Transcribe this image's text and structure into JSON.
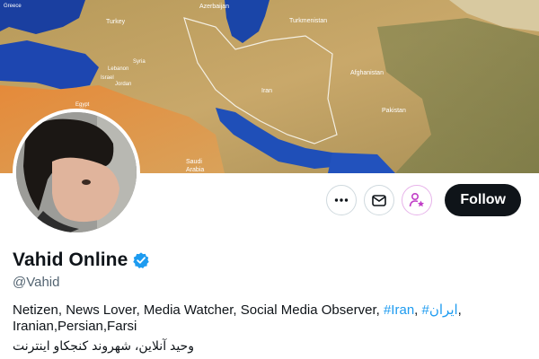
{
  "banner": {
    "map_labels": {
      "georgia": "Azerbaijan",
      "turkey": "Turkey",
      "turkmenistan": "Turkmenistan",
      "afghanistan": "Afghanistan",
      "iran": "Iran",
      "pakistan": "Pakistan",
      "saudi": "Saudi",
      "arabia": "Arabia",
      "greece": "Greece",
      "lebanon": "Lebanon",
      "jordan": "Jordan",
      "israel": "Israel",
      "egypt": "Egypt",
      "syria": "Syria"
    }
  },
  "actions": {
    "more_icon": "more-horizontal-icon",
    "message_icon": "envelope-icon",
    "subscribe_icon": "person-star-icon",
    "follow_label": "Follow"
  },
  "profile": {
    "display_name": "Vahid Online",
    "handle": "@Vahid",
    "verified_icon": "verified-badge-icon",
    "bio_prefix": "Netizen, News Lover, Media Watcher, Social Media Observer, ",
    "hashtag_1": "#Iran",
    "separator": ", ",
    "hashtag_2": "#ایران",
    "bio_suffix": ",",
    "bio_line2": "Iranian,Persian,Farsi",
    "bio_line3": "وحید آنلاین، شهروند کنجکاو اینترنت"
  },
  "colors": {
    "accent": "#1d9bf0",
    "follow_bg": "#0f1419",
    "subscribe_icon": "#c13fc7"
  }
}
